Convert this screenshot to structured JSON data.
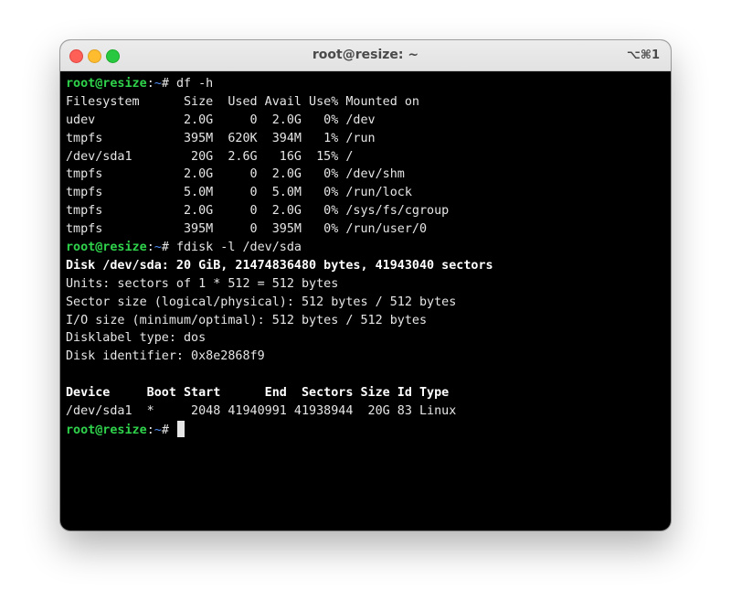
{
  "window": {
    "title": "root@resize: ~",
    "shortcut": "⌥⌘1"
  },
  "prompt": {
    "user_host": "root@resize",
    "path": "~",
    "symbol": "# "
  },
  "terminal": {
    "cmd_df": "df -h",
    "df_header": "Filesystem      Size  Used Avail Use% Mounted on",
    "df_rows": [
      "udev            2.0G     0  2.0G   0% /dev",
      "tmpfs           395M  620K  394M   1% /run",
      "/dev/sda1        20G  2.6G   16G  15% /",
      "tmpfs           2.0G     0  2.0G   0% /dev/shm",
      "tmpfs           5.0M     0  5.0M   0% /run/lock",
      "tmpfs           2.0G     0  2.0G   0% /sys/fs/cgroup",
      "tmpfs           395M     0  395M   0% /run/user/0"
    ],
    "cmd_fdisk": "fdisk -l /dev/sda",
    "fdisk_disk": "Disk /dev/sda: 20 GiB, 21474836480 bytes, 41943040 sectors",
    "fdisk_info": [
      "Units: sectors of 1 * 512 = 512 bytes",
      "Sector size (logical/physical): 512 bytes / 512 bytes",
      "I/O size (minimum/optimal): 512 bytes / 512 bytes",
      "Disklabel type: dos",
      "Disk identifier: 0x8e2868f9"
    ],
    "part_header": "Device     Boot Start      End  Sectors Size Id Type",
    "part_row": "/dev/sda1  *     2048 41940991 41938944  20G 83 Linux"
  },
  "colors": {
    "terminal_bg": "#000000",
    "prompt_user": "#2fd24b",
    "prompt_path": "#4f8ef7",
    "text": "#e6e6e6"
  }
}
